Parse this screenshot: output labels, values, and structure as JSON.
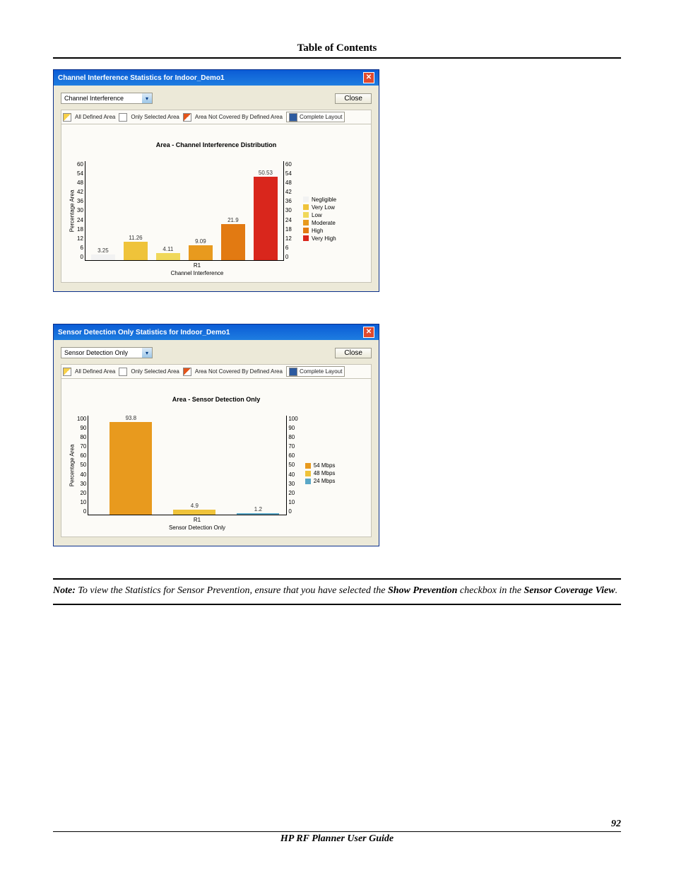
{
  "header": {
    "toc": "Table of Contents"
  },
  "dialog1": {
    "title": "Channel Interference Statistics for Indoor_Demo1",
    "select_value": "Channel Interference",
    "close_label": "Close",
    "tabs": {
      "all_defined": "All Defined Area",
      "only_selected": "Only Selected Area",
      "not_covered": "Area Not Covered By Defined Area",
      "complete": "Complete Layout"
    }
  },
  "dialog2": {
    "title": "Sensor Detection Only Statistics for Indoor_Demo1",
    "select_value": "Sensor Detection Only",
    "close_label": "Close",
    "tabs": {
      "all_defined": "All Defined Area",
      "only_selected": "Only Selected Area",
      "not_covered": "Area Not Covered By Defined Area",
      "complete": "Complete Layout"
    }
  },
  "chart_data": [
    {
      "type": "bar",
      "title": "Area - Channel Interference Distribution",
      "xlabel": "Channel Interference",
      "ylabel": "Percentage Area",
      "x_category": "R1",
      "ylim": [
        0,
        60
      ],
      "y_ticks": [
        60,
        54,
        48,
        42,
        36,
        30,
        24,
        18,
        12,
        6,
        0
      ],
      "series": [
        {
          "name": "Negligible",
          "color": "#f2f2f2",
          "value": 3.25
        },
        {
          "name": "Very Low",
          "color": "#efc33a",
          "value": 11.26
        },
        {
          "name": "Low",
          "color": "#f0d85a",
          "value": 4.11
        },
        {
          "name": "Moderate",
          "color": "#e89a1e",
          "value": 9.09
        },
        {
          "name": "High",
          "color": "#e27a12",
          "value": 21.9
        },
        {
          "name": "Very High",
          "color": "#d9261c",
          "value": 50.53
        }
      ]
    },
    {
      "type": "bar",
      "title": "Area - Sensor Detection Only",
      "xlabel": "Sensor Detection Only",
      "ylabel": "Percentage Area",
      "x_category": "R1",
      "ylim": [
        0,
        100
      ],
      "y_ticks": [
        100,
        90,
        80,
        70,
        60,
        50,
        40,
        30,
        20,
        10,
        0
      ],
      "series": [
        {
          "name": "54 Mbps",
          "color": "#e89a1e",
          "value": 93.8
        },
        {
          "name": "48 Mbps",
          "color": "#efc33a",
          "value": 4.9
        },
        {
          "name": "24 Mbps",
          "color": "#5aa7c7",
          "value": 1.2
        }
      ]
    }
  ],
  "note": {
    "prefix": "Note:",
    "body_a": " To view the Statistics for Sensor Prevention, ensure that you have selected the ",
    "show_prev": "Show Prevention",
    "body_b": " checkbox in the ",
    "scv": "Sensor Coverage View",
    "body_c": "."
  },
  "footer": {
    "page": "92",
    "title": "HP RF Planner User Guide"
  }
}
